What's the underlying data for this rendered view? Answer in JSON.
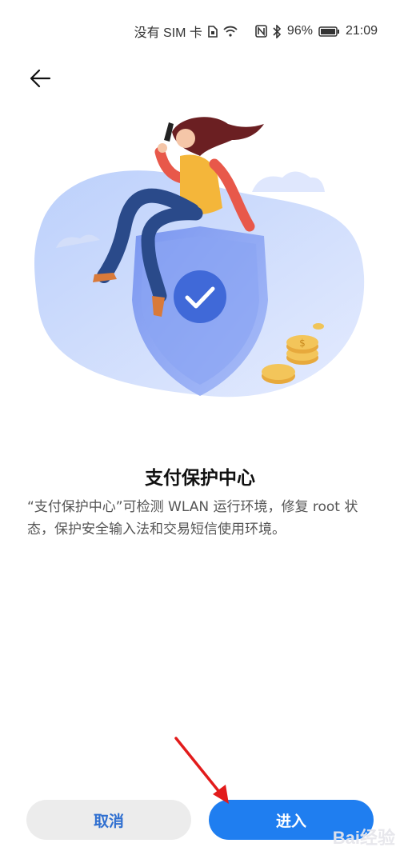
{
  "status_bar": {
    "sim_text": "没有 SIM 卡",
    "battery": "96%",
    "time": "21:09"
  },
  "page": {
    "title": "支付保护中心",
    "description": "“支付保护中心”可检测 WLAN 运行环境，修复 root 状态，保护安全输入法和交易短信使用环境。"
  },
  "buttons": {
    "cancel": "取消",
    "enter": "进入"
  },
  "watermark": "Bai经验",
  "colors": {
    "primary": "#1f7ef0",
    "cancel_bg": "#ececec",
    "cancel_text": "#2f6fd0",
    "annotation_arrow": "#e21b1b"
  }
}
